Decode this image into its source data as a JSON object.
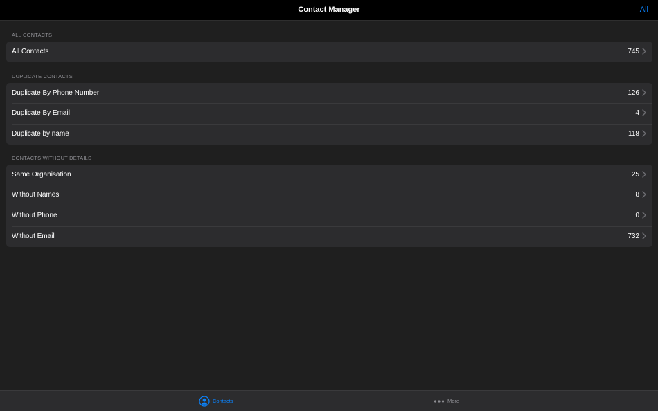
{
  "header": {
    "title": "Contact Manager",
    "action_label": "All"
  },
  "sections": [
    {
      "title": "ALL CONTACTS",
      "rows": [
        {
          "label": "All Contacts",
          "count": "745"
        }
      ]
    },
    {
      "title": "DUPLICATE CONTACTS",
      "rows": [
        {
          "label": "Duplicate By Phone Number",
          "count": "126"
        },
        {
          "label": "Duplicate By Email",
          "count": "4"
        },
        {
          "label": "Duplicate by name",
          "count": "118"
        }
      ]
    },
    {
      "title": "CONTACTS WITHOUT DETAILS",
      "rows": [
        {
          "label": "Same Organisation",
          "count": "25"
        },
        {
          "label": "Without Names",
          "count": "8"
        },
        {
          "label": "Without Phone",
          "count": "0"
        },
        {
          "label": "Without Email",
          "count": "732"
        }
      ]
    }
  ],
  "tabbar": {
    "tabs": [
      {
        "label": "Contacts",
        "icon": "person-circle-icon",
        "selected": true
      },
      {
        "label": "More",
        "icon": "ellipsis-icon",
        "selected": false
      }
    ]
  },
  "colors": {
    "accent": "#0a84ff",
    "background": "#1f1f1f",
    "header_bg": "#000000",
    "group_bg": "#2c2c2e",
    "secondary_text": "#8e8e93"
  }
}
